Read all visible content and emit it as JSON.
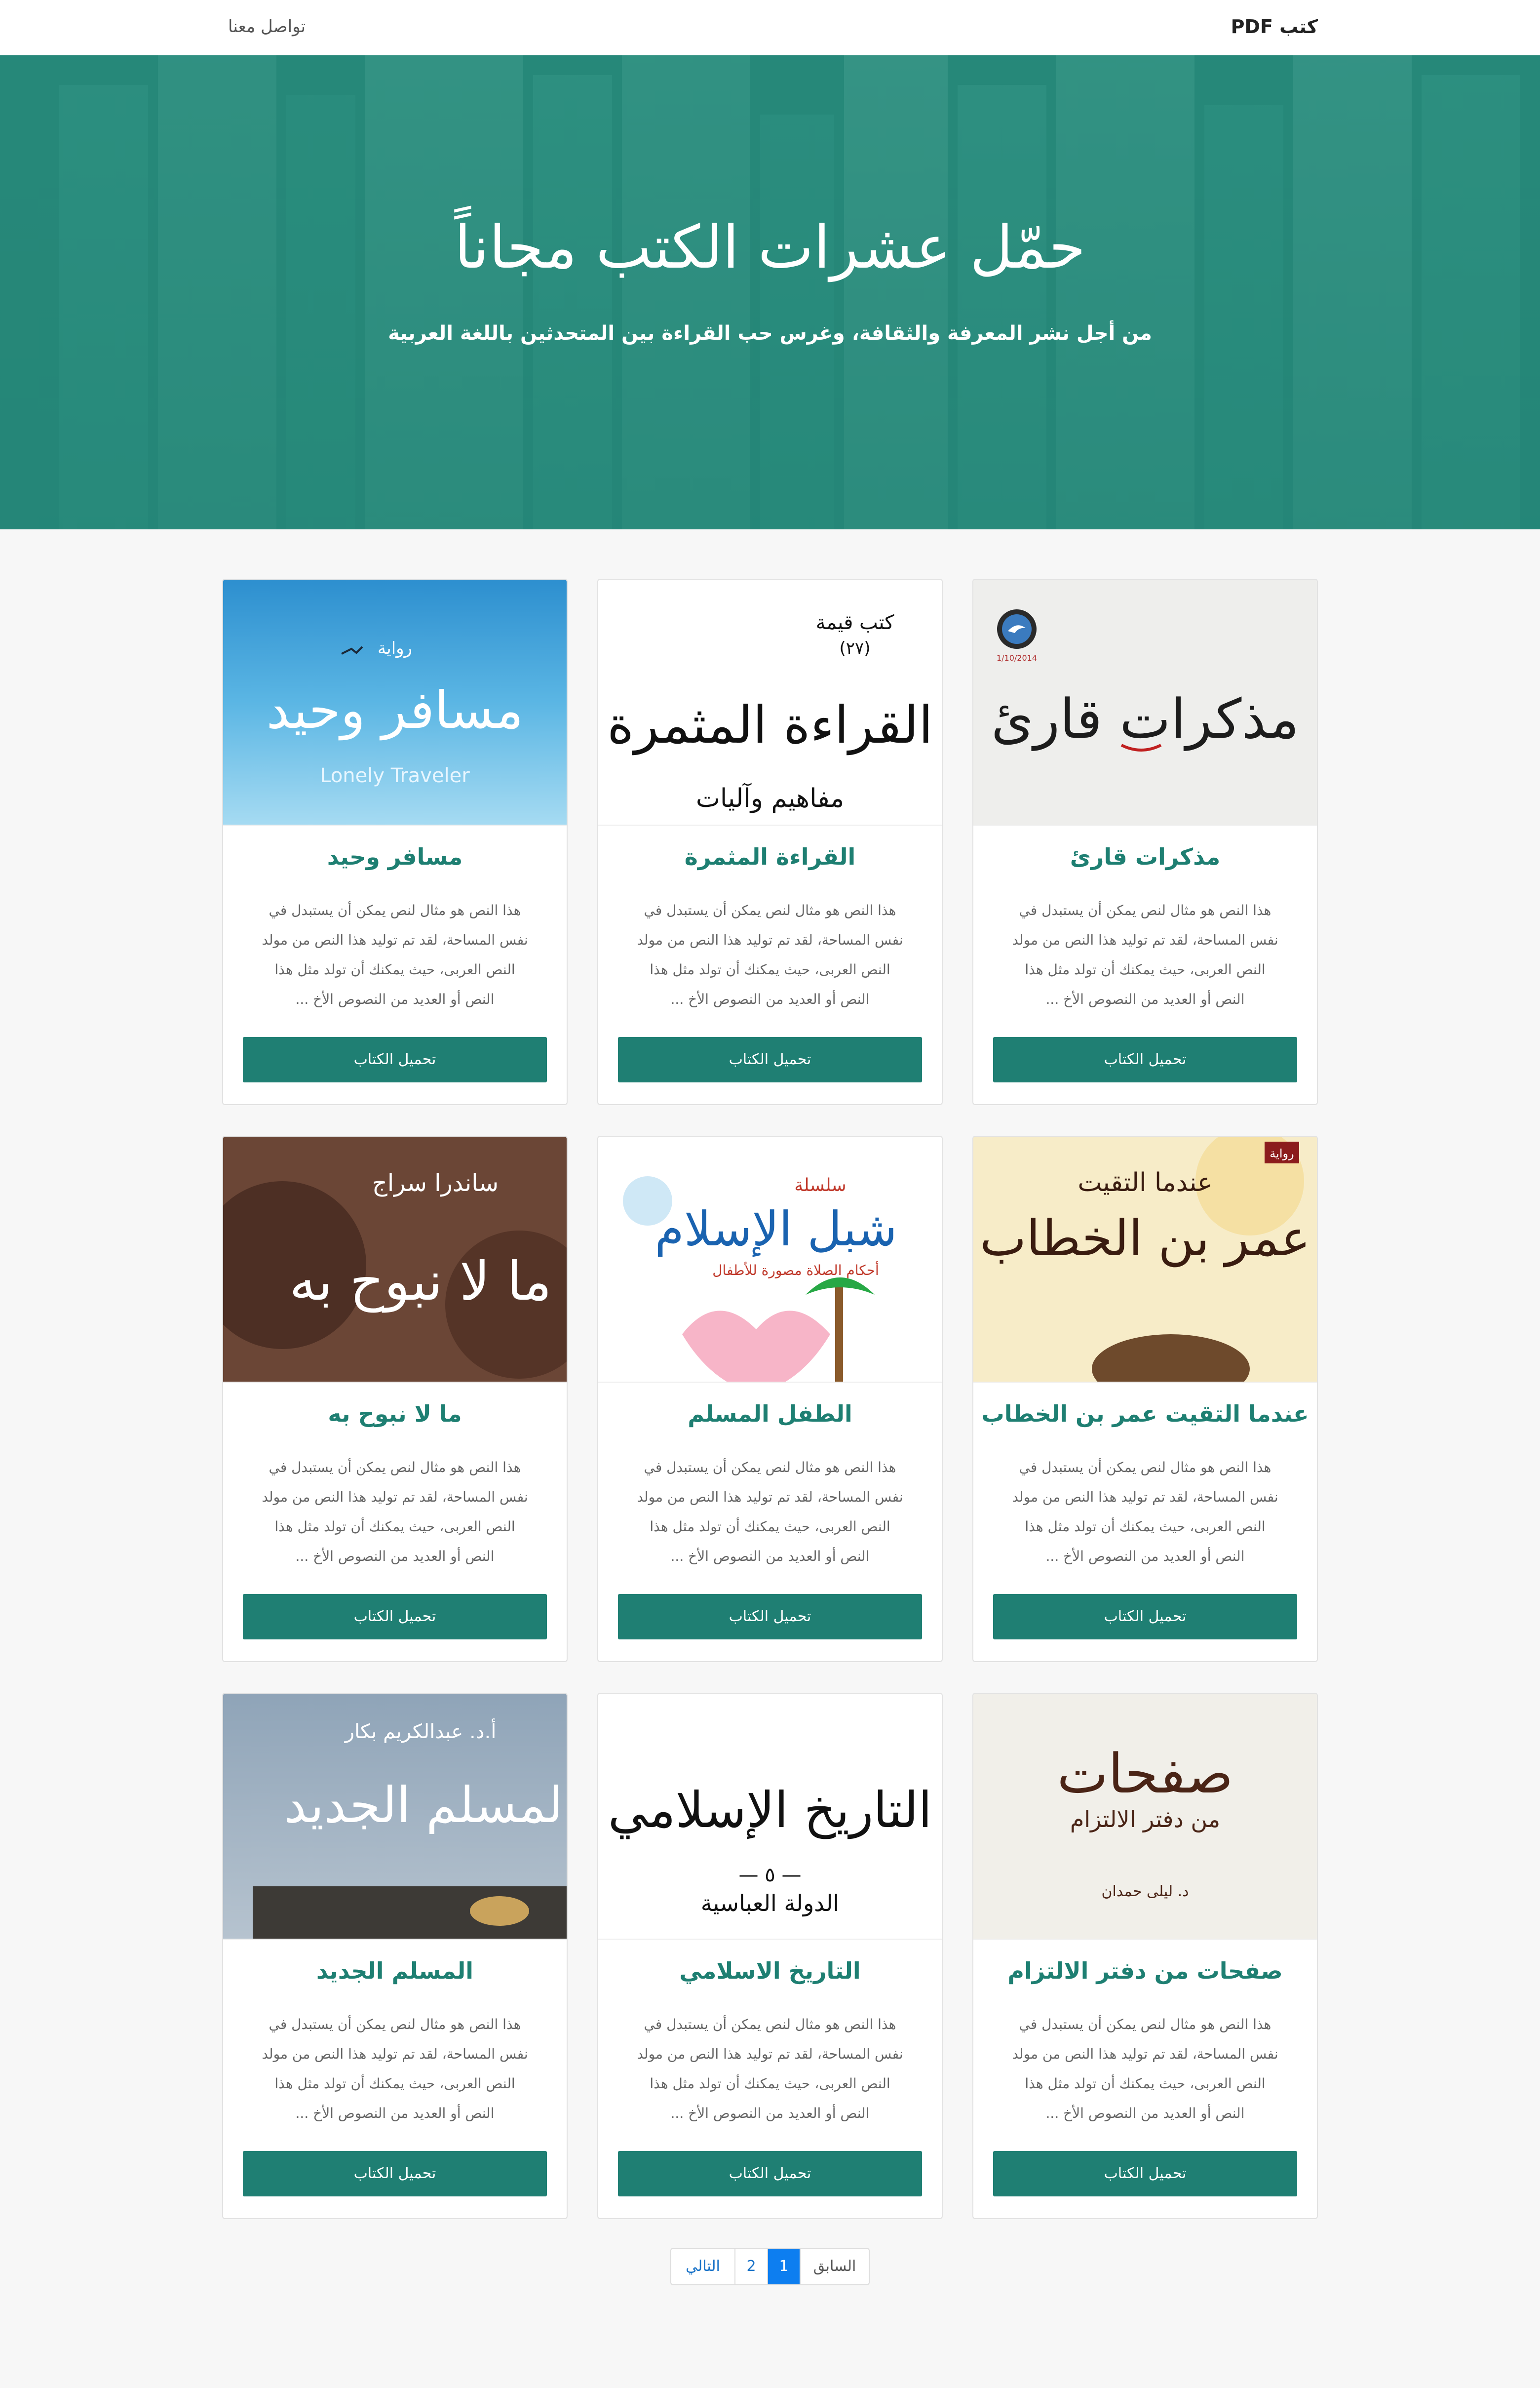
{
  "navbar": {
    "brand": "كتب PDF",
    "contact": "تواصل معنا"
  },
  "hero": {
    "title": "حمّل عشرات الكتب مجاناً",
    "subtitle": "من أجل نشر المعرفة والثقافة، وغرس حب القراءة بين المتحدثين باللغة العربية"
  },
  "book_desc_lines": [
    "هذا النص هو مثال لنص يمكن أن يستبدل في",
    "نفس المساحة، لقد تم توليد هذا النص من مولد",
    "النص العربى، حيث يمكنك أن تولد مثل هذا",
    "النص أو العديد من النصوص الأخ ..."
  ],
  "download_label": "تحميل الكتاب",
  "books": [
    {
      "title": "مذكرات قارئ",
      "cover": {
        "text": "مذكرات قارئ",
        "date": "1/10/2014",
        "bg": "#f2f2f2"
      }
    },
    {
      "title": "القراءة المثمرة",
      "cover": {
        "text": "القراءة المثمرة",
        "series": "كتب قيمة",
        "num": "(٢٧)",
        "sub": "مفاهيم وآليات",
        "bg": "#ffffff"
      }
    },
    {
      "title": "مسافر وحيد",
      "cover": {
        "text": "مسافر وحيد",
        "label": "رواية",
        "en": "Lonely Traveler",
        "bg": "#3a9fd6"
      }
    },
    {
      "title": "عندما التقيت عمر بن الخطاب",
      "cover": {
        "text": "عمر بن الخطاب",
        "top": "عندما التقيت",
        "tag": "رواية",
        "bg": "#f7ecc8"
      }
    },
    {
      "title": "الطفل المسلم",
      "cover": {
        "text": "شبل الإسلام",
        "top": "سلسلة",
        "sub": "أحكام الصلاة مصورة للأطفال",
        "bg": "#ffffff"
      }
    },
    {
      "title": "ما لا نبوح به",
      "cover": {
        "text": "ما لا نبوح به",
        "author": "ساندرا سراج",
        "bg": "#6b4636"
      }
    },
    {
      "title": "صفحات من دفتر الالتزام",
      "cover": {
        "text": "صفحات",
        "sub": "من دفتر الالتزام",
        "author": "د. ليلى حمدان",
        "bg": "#f1efe9"
      }
    },
    {
      "title": "التاريخ الاسلامي",
      "cover": {
        "text": "التاريخ الإسلامي",
        "num": "— ٥ —",
        "sub": "الدولة العباسية",
        "bg": "#ffffff"
      }
    },
    {
      "title": "المسلم الجديد",
      "cover": {
        "text": "المسلم الجديد",
        "author": "أ.د. عبدالكريم بكار",
        "bg": "#8fa4b8"
      }
    }
  ],
  "pagination": {
    "prev": "السابق",
    "current": "1",
    "page2": "2",
    "next": "التالي"
  },
  "colors": {
    "accent": "#1f7f73",
    "hero": "#2b8a7c",
    "active_page": "#0d7ef0"
  }
}
